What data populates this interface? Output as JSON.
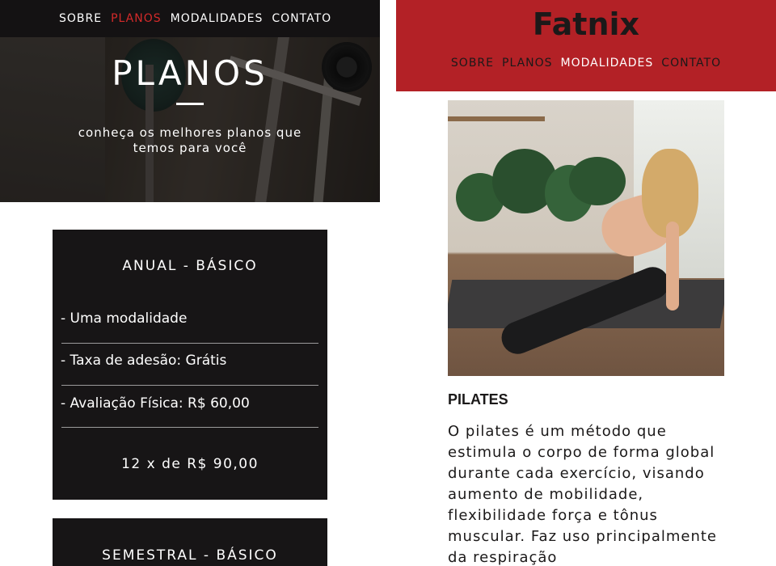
{
  "left_screen": {
    "nav": {
      "items": [
        {
          "label": "SOBRE",
          "active": false
        },
        {
          "label": "PLANOS",
          "active": true
        },
        {
          "label": "MODALIDADES",
          "active": false
        },
        {
          "label": "CONTATO",
          "active": false
        }
      ]
    },
    "hero": {
      "title": "PLANOS",
      "subtitle": "conheça os melhores planos que temos para você"
    },
    "plans": [
      {
        "title": "ANUAL - BÁSICO",
        "features": [
          "- Uma modalidade",
          "- Taxa de adesão: Grátis",
          "- Avaliação Física: R$ 60,00"
        ],
        "price": "12 x de R$ 90,00"
      },
      {
        "title": "SEMESTRAL - BÁSICO"
      }
    ]
  },
  "right_screen": {
    "brand": "Fatnix",
    "nav": {
      "items": [
        {
          "label": "SOBRE",
          "active": false
        },
        {
          "label": "PLANOS",
          "active": false
        },
        {
          "label": "MODALIDADES",
          "active": true
        },
        {
          "label": "CONTATO",
          "active": false
        }
      ]
    },
    "modality": {
      "title": "PILATES",
      "description": "O pilates é um método que estimula o corpo de forma global durante cada exercício, visando aumento de mobilidade, flexibilidade força e tônus muscular. Faz uso principalmente da respiração"
    }
  },
  "colors": {
    "accent_red": "#b32126",
    "active_link_red": "#d42a2a",
    "card_bg": "#171516"
  }
}
